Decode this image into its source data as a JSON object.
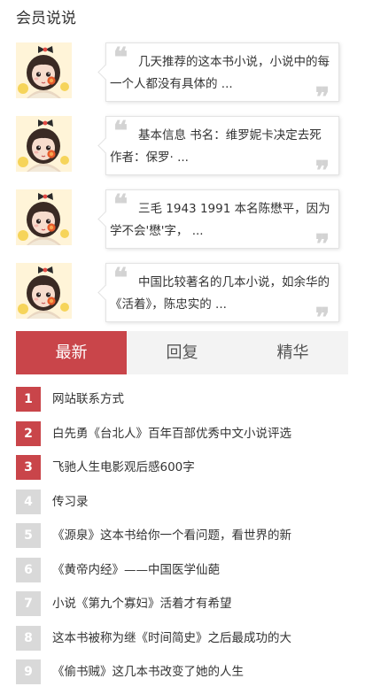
{
  "section_title": "会员说说",
  "comments": [
    {
      "text": "几天推荐的这本书小说，小说中的每一个人都没有具体的 ..."
    },
    {
      "text": "基本信息 书名：维罗妮卡决定去死 作者：保罗· ..."
    },
    {
      "text": "三毛 1943 1991 本名陈懋平，因为学不会'懋'字， ..."
    },
    {
      "text": "中国比较著名的几本小说，如余华的《活着》，陈忠实的 ..."
    }
  ],
  "quote_open": "❝",
  "quote_close": "❞",
  "tabs": [
    {
      "label": "最新",
      "active": true
    },
    {
      "label": "回复",
      "active": false
    },
    {
      "label": "精华",
      "active": false
    }
  ],
  "rank_list": [
    {
      "num": "1",
      "title": "网站联系方式",
      "hot": true
    },
    {
      "num": "2",
      "title": "白先勇《台北人》百年百部优秀中文小说评选",
      "hot": true
    },
    {
      "num": "3",
      "title": "飞驰人生电影观后感600字",
      "hot": true
    },
    {
      "num": "4",
      "title": "传习录",
      "hot": false
    },
    {
      "num": "5",
      "title": "《源泉》这本书给你一个看问题，看世界的新",
      "hot": false
    },
    {
      "num": "6",
      "title": "《黄帝内经》——中国医学仙葩",
      "hot": false
    },
    {
      "num": "7",
      "title": "小说《第九个寡妇》活着才有希望",
      "hot": false
    },
    {
      "num": "8",
      "title": "这本书被称为继《时间简史》之后最成功的大",
      "hot": false
    },
    {
      "num": "9",
      "title": "《偷书贼》这几本书改变了她的人生",
      "hot": false
    }
  ],
  "colors": {
    "accent": "#c9454a",
    "rank_inactive": "#d9d9d9",
    "tab_bg": "#f3f3f3"
  }
}
